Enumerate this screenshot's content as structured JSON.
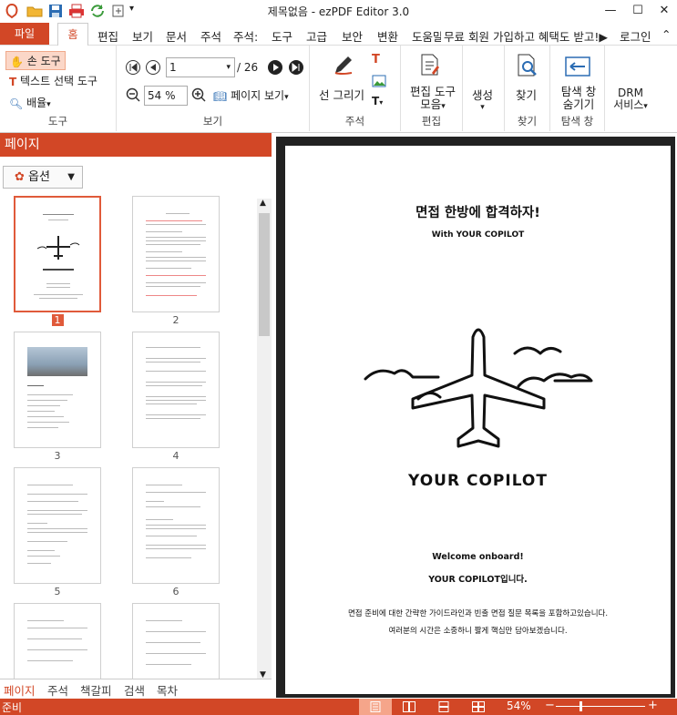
{
  "window": {
    "title": "제목없음 - ezPDF Editor 3.0",
    "minimize": "—",
    "maximize": "☐",
    "close": "✕"
  },
  "menu": {
    "file": "파일",
    "tabs": [
      "홈",
      "편집",
      "보기",
      "문서",
      "주석",
      "주석:",
      "도구",
      "고급",
      "보안",
      "변환",
      "도움말"
    ],
    "promo": "무료 회원 가입하고 혜택도 받고!▶",
    "login": "로그인",
    "collapse": "⌃"
  },
  "ribbon": {
    "tools": {
      "hand": "손 도구",
      "text_select": "텍스트 선택 도구",
      "zoom": "배율",
      "label": "도구"
    },
    "view": {
      "page": "1",
      "total": "/ 26",
      "zoom": "54 %",
      "page_view": "페이지 보기",
      "label": "보기"
    },
    "annot": {
      "draw": "선 그리기",
      "label": "주석"
    },
    "edit": {
      "tools": "편집 도구",
      "tools2": "모음",
      "label": "편집"
    },
    "create": {
      "label": "생성"
    },
    "find": {
      "find": "찾기",
      "label": "찾기"
    },
    "nav": {
      "hide": "탐색 창",
      "hide2": "숨기기",
      "label": "탐색 창"
    },
    "drm": {
      "line1": "DRM",
      "line2": "서비스"
    }
  },
  "panel": {
    "title": "페이지",
    "options": "옵션",
    "thumbs": [
      "1",
      "2",
      "3",
      "4",
      "5",
      "6"
    ],
    "tabs": [
      "페이지",
      "주석",
      "책갈피",
      "검색",
      "목차"
    ]
  },
  "document": {
    "heading": "면접 한방에 합격하자!",
    "sub": "With YOUR COPILOT",
    "logo_text": "YOUR COPILOT",
    "welcome": "Welcome onboard!",
    "welcome2": "YOUR COPILOT입니다.",
    "desc1": "면접 준비에 대한 간략한 가이드라인과 빈출 면접 질문 목록을 포함하고있습니다.",
    "desc2": "여러분의 시간은 소중하니 짧게 핵심만 담아보겠습니다."
  },
  "status": {
    "ready": "준비",
    "zoom": "54%",
    "minus": "−",
    "plus": "+"
  },
  "colors": {
    "accent": "#d24726"
  }
}
